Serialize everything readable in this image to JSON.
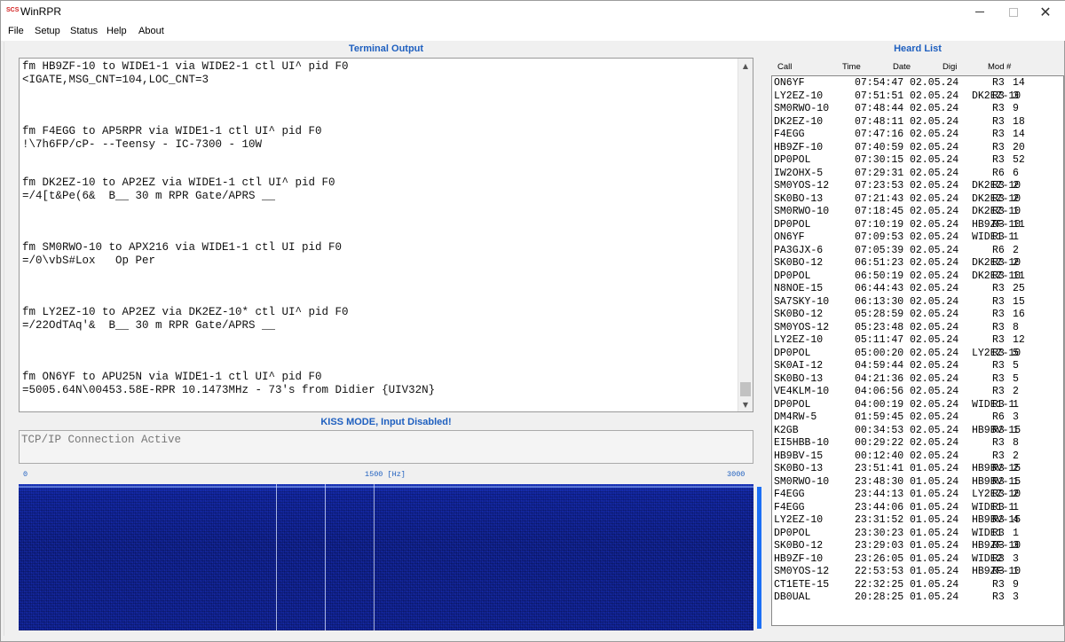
{
  "window": {
    "logo": "SCS",
    "title": "WinRPR",
    "close_glyph": "✕"
  },
  "menu": [
    "File",
    "Setup",
    "Status",
    "Help",
    "About"
  ],
  "terminal": {
    "header": "Terminal Output",
    "lines": [
      "fm HB9ZF-10 to WIDE1-1 via WIDE2-1 ctl UI^ pid F0",
      "<IGATE,MSG_CNT=104,LOC_CNT=3",
      "",
      "",
      "",
      "fm F4EGG to AP5RPR via WIDE1-1 ctl UI^ pid F0",
      "!\\7h6FP/cP- --Teensy - IC-7300 - 10W",
      "",
      "",
      "fm DK2EZ-10 to AP2EZ via WIDE1-1 ctl UI^ pid F0",
      "=/4[t&Pe(6&  B__ 30 m RPR Gate/APRS __",
      "",
      "",
      "",
      "fm SM0RWO-10 to APX216 via WIDE1-1 ctl UI pid F0",
      "=/0\\vbS#Lox   Op Per",
      "",
      "",
      "",
      "fm LY2EZ-10 to AP2EZ via DK2EZ-10* ctl UI^ pid F0",
      "=/22OdTAq'&  B__ 30 m RPR Gate/APRS __",
      "",
      "",
      "",
      "fm ON6YF to APU25N via WIDE1-1 ctl UI^ pid F0",
      "=5005.64N\\00453.58E-RPR 10.1473MHz - 73's from Didier {UIV32N}"
    ],
    "scroll_up": "▲",
    "scroll_down": "▼"
  },
  "kiss": {
    "header": "KISS MODE, Input Disabled!",
    "input_value": "TCP/IP Connection Active"
  },
  "spectrum": {
    "tick_min": "0",
    "tick_mid": "1500 [Hz]",
    "tick_max": "3000",
    "marker_hz": [
      1050,
      1250,
      1450
    ]
  },
  "heard": {
    "header": "Heard List",
    "columns": [
      "Call",
      "Time",
      "Date",
      "Digi",
      "Mod",
      "#"
    ],
    "rows": [
      [
        "ON6YF",
        "07:54:47",
        "02.05.24",
        "",
        "R3",
        "14"
      ],
      [
        "LY2EZ-10",
        "07:51:51",
        "02.05.24",
        "DK2EZ-10",
        "R3",
        "3"
      ],
      [
        "SM0RWO-10",
        "07:48:44",
        "02.05.24",
        "",
        "R3",
        "9"
      ],
      [
        "DK2EZ-10",
        "07:48:11",
        "02.05.24",
        "",
        "R3",
        "18"
      ],
      [
        "F4EGG",
        "07:47:16",
        "02.05.24",
        "",
        "R3",
        "14"
      ],
      [
        "HB9ZF-10",
        "07:40:59",
        "02.05.24",
        "",
        "R3",
        "20"
      ],
      [
        "DP0POL",
        "07:30:15",
        "02.05.24",
        "",
        "R3",
        "52"
      ],
      [
        "IW2OHX-5",
        "07:29:31",
        "02.05.24",
        "",
        "R6",
        "6"
      ],
      [
        "SM0YOS-12",
        "07:23:53",
        "02.05.24",
        "DK2EZ-10",
        "R3",
        "2"
      ],
      [
        "SK0BO-13",
        "07:21:43",
        "02.05.24",
        "DK2EZ-10",
        "R3",
        "2"
      ],
      [
        "SM0RWO-10",
        "07:18:45",
        "02.05.24",
        "DK2EZ-10",
        "R3",
        "1"
      ],
      [
        "DP0POL",
        "07:10:19",
        "02.05.24",
        "HB9ZF-10",
        "R3",
        "11"
      ],
      [
        "ON6YF",
        "07:09:53",
        "02.05.24",
        "WIDE1-1",
        "R3",
        "1"
      ],
      [
        "PA3GJX-6",
        "07:05:39",
        "02.05.24",
        "",
        "R6",
        "2"
      ],
      [
        "SK0BO-12",
        "06:51:23",
        "02.05.24",
        "DK2EZ-10",
        "R3",
        "2"
      ],
      [
        "DP0POL",
        "06:50:19",
        "02.05.24",
        "DK2EZ-10",
        "R3",
        "11"
      ],
      [
        "N8NOE-15",
        "06:44:43",
        "02.05.24",
        "",
        "R3",
        "25"
      ],
      [
        "SA7SKY-10",
        "06:13:30",
        "02.05.24",
        "",
        "R3",
        "15"
      ],
      [
        "SK0BO-12",
        "05:28:59",
        "02.05.24",
        "",
        "R3",
        "16"
      ],
      [
        "SM0YOS-12",
        "05:23:48",
        "02.05.24",
        "",
        "R3",
        "8"
      ],
      [
        "LY2EZ-10",
        "05:11:47",
        "02.05.24",
        "",
        "R3",
        "12"
      ],
      [
        "DP0POL",
        "05:00:20",
        "02.05.24",
        "LY2EZ-10",
        "R3",
        "5"
      ],
      [
        "SK0AI-12",
        "04:59:44",
        "02.05.24",
        "",
        "R3",
        "5"
      ],
      [
        "SK0BO-13",
        "04:21:36",
        "02.05.24",
        "",
        "R3",
        "5"
      ],
      [
        "VE4KLM-10",
        "04:06:56",
        "02.05.24",
        "",
        "R3",
        "2"
      ],
      [
        "DP0POL",
        "04:00:19",
        "02.05.24",
        "WIDE1-1",
        "R3",
        "1"
      ],
      [
        "DM4RW-5",
        "01:59:45",
        "02.05.24",
        "",
        "R6",
        "3"
      ],
      [
        "K2GB",
        "00:34:53",
        "02.05.24",
        "HB9BV-15",
        "R3",
        "1"
      ],
      [
        "EI5HBB-10",
        "00:29:22",
        "02.05.24",
        "",
        "R3",
        "8"
      ],
      [
        "HB9BV-15",
        "00:12:40",
        "02.05.24",
        "",
        "R3",
        "2"
      ],
      [
        "SK0BO-13",
        "23:51:41",
        "01.05.24",
        "HB9BV-15",
        "R3",
        "2"
      ],
      [
        "SM0RWO-10",
        "23:48:30",
        "01.05.24",
        "HB9BV-15",
        "R3",
        "1"
      ],
      [
        "F4EGG",
        "23:44:13",
        "01.05.24",
        "LY2EZ-10",
        "R3",
        "2"
      ],
      [
        "F4EGG",
        "23:44:06",
        "01.05.24",
        "WIDE1-1",
        "R3",
        "1"
      ],
      [
        "LY2EZ-10",
        "23:31:52",
        "01.05.24",
        "HB9BV-15",
        "R3",
        "4"
      ],
      [
        "DP0POL",
        "23:30:23",
        "01.05.24",
        "WIDE1",
        "R3",
        "1"
      ],
      [
        "SK0BO-12",
        "23:29:03",
        "01.05.24",
        "HB9ZF-10",
        "R3",
        "3"
      ],
      [
        "HB9ZF-10",
        "23:26:05",
        "01.05.24",
        "WIDE2",
        "R3",
        "3"
      ],
      [
        "SM0YOS-12",
        "22:53:53",
        "01.05.24",
        "HB9ZF-10",
        "R3",
        "1"
      ],
      [
        "CT1ETE-15",
        "22:32:25",
        "01.05.24",
        "",
        "R3",
        "9"
      ],
      [
        "DB0UAL",
        "20:28:25",
        "01.05.24",
        "",
        "R3",
        "3"
      ]
    ]
  }
}
